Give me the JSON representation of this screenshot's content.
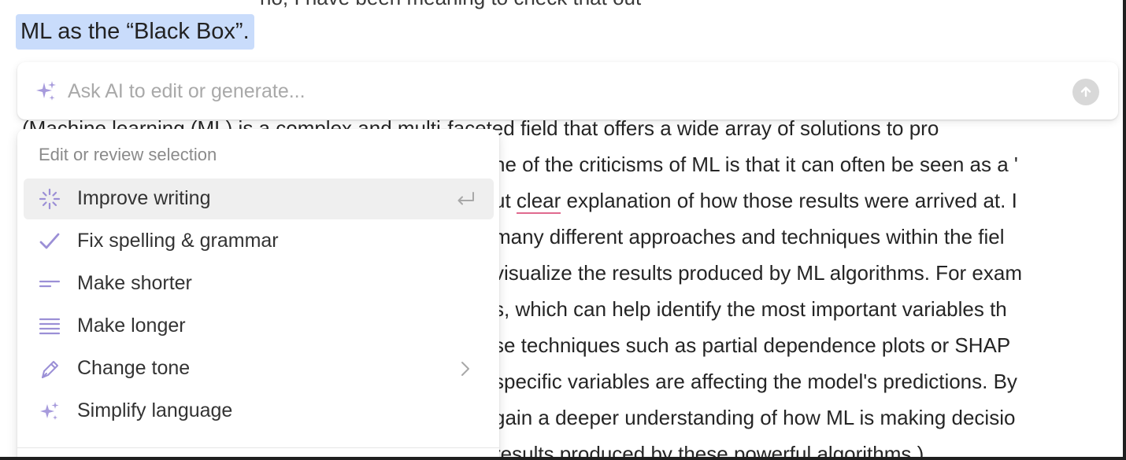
{
  "document": {
    "top_clipped_text": "no, I have been meaning to check that out",
    "heading": "ML as the “Black Box”.",
    "body_lines": [
      "(Machine learning (ML) is a complex and multi-faceted field that offers a wide array of solutions to pro",
      "ne of the criticisms of ML is that it can often be seen as a '",
      "ut ",
      "many different approaches and techniques within the fiel",
      "visualize the results produced by ML algorithms. For exam",
      "s, which can help identify the most important variables th",
      "se techniques such as partial dependence plots or SHAP",
      "specific variables are affecting the model's predictions. By",
      "gain a deeper understanding of how ML is making decisio",
      "results produced by these powerful algorithms.)"
    ],
    "misspelled_word": "clear",
    "line3_tail": " explanation of how those results were arrived at. I"
  },
  "ai_prompt": {
    "placeholder": "Ask AI to edit or generate...",
    "sparkle_icon": "sparkle-icon",
    "send_icon": "arrow-up-icon"
  },
  "menu": {
    "heading": "Edit or review selection",
    "items": [
      {
        "label": "Improve writing",
        "icon": "sparkle-burst-icon",
        "trail": "enter-key-icon",
        "selected": true
      },
      {
        "label": "Fix spelling & grammar",
        "icon": "checkmark-icon"
      },
      {
        "label": "Make shorter",
        "icon": "short-lines-icon"
      },
      {
        "label": "Make longer",
        "icon": "long-lines-icon"
      },
      {
        "label": "Change tone",
        "icon": "pen-icon",
        "trail": "chevron-right-icon"
      },
      {
        "label": "Simplify language",
        "icon": "sparkle-icon"
      }
    ]
  },
  "colors": {
    "accent_purple": "#9b8fd6",
    "selection_highlight": "#c9dcfb",
    "spellcheck_underline": "#e06a8f"
  }
}
